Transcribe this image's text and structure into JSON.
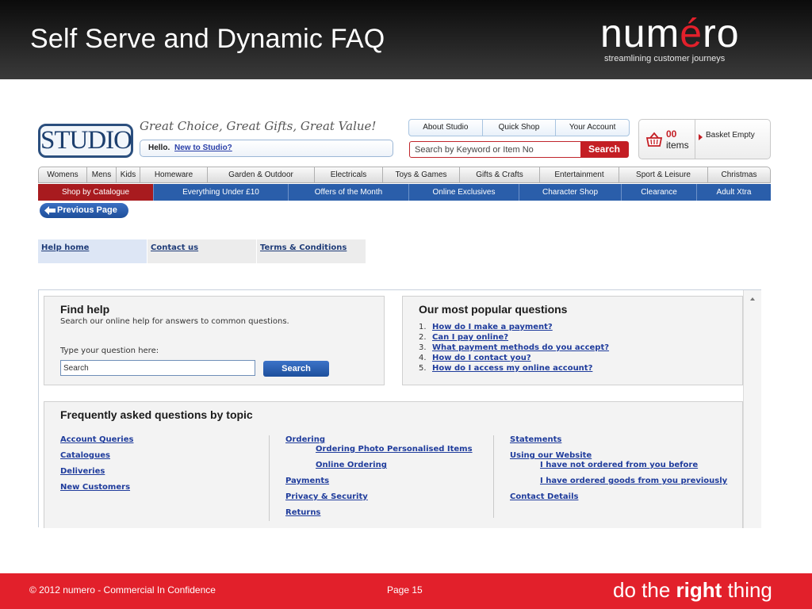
{
  "slide": {
    "title": "Self Serve and Dynamic FAQ",
    "brand": {
      "name_part1": "num",
      "name_accent": "é",
      "name_part2": "ro",
      "tagline": "streamlining customer journeys"
    },
    "footer": {
      "copyright": "© 2012 numero  - Commercial In Confidence",
      "page": "Page 15",
      "slogan_pre": "do the ",
      "slogan_bold": "right",
      "slogan_post": " thing"
    }
  },
  "site": {
    "logo": "STUDIO",
    "tagline": "Great Choice, Great Gifts, Great Value!",
    "hello": {
      "text": "Hello.",
      "link": "New to Studio?"
    },
    "top_links": [
      "About Studio",
      "Quick Shop",
      "Your Account"
    ],
    "search": {
      "placeholder": "Search by Keyword or Item No",
      "button": "Search"
    },
    "basket": {
      "count": "00",
      "items_label": "items",
      "status": "Basket Empty",
      "icon": "basket-icon"
    },
    "category_nav": [
      "Womens",
      "Mens",
      "Kids",
      "Homeware",
      "Garden & Outdoor",
      "Electricals",
      "Toys & Games",
      "Gifts & Crafts",
      "Entertainment",
      "Sport & Leisure",
      "Christmas"
    ],
    "sub_nav": [
      "Shop by Catalogue",
      "Everything Under £10",
      "Offers of the Month",
      "Online Exclusives",
      "Character Shop",
      "Clearance",
      "Adult Xtra"
    ],
    "previous_page": "Previous Page",
    "help_tabs": [
      "Help home",
      "Contact us",
      "Terms & Conditions"
    ],
    "find_help": {
      "title": "Find help",
      "subtitle": "Search our online help for answers to common questions.",
      "question_label": "Type your question here:",
      "input_placeholder": "Search",
      "button": "Search"
    },
    "popular": {
      "title": "Our most popular questions",
      "questions": [
        "How do I make a payment?",
        "Can I pay online?",
        "What payment methods do you accept?",
        "How do I contact you?",
        "How do I access my online account?"
      ]
    },
    "faq_topics": {
      "title": "Frequently asked questions by topic",
      "col1": [
        "Account Queries",
        "Catalogues",
        "Deliveries",
        "New Customers"
      ],
      "col2": {
        "ordering": "Ordering",
        "ordering_sub": [
          "Ordering Photo Personalised Items",
          "Online Ordering"
        ],
        "rest": [
          "Payments",
          "Privacy & Security",
          "Returns"
        ]
      },
      "col3": {
        "statements": "Statements",
        "using": "Using our Website",
        "using_sub": [
          "I have not ordered from you before",
          "I have ordered goods from you previously"
        ],
        "contact": "Contact Details"
      }
    }
  },
  "colors": {
    "brand_red": "#e2202b",
    "studio_blue": "#2a5eaa",
    "link_blue": "#1f3c9c",
    "catalogue_red": "#a81b1f"
  }
}
